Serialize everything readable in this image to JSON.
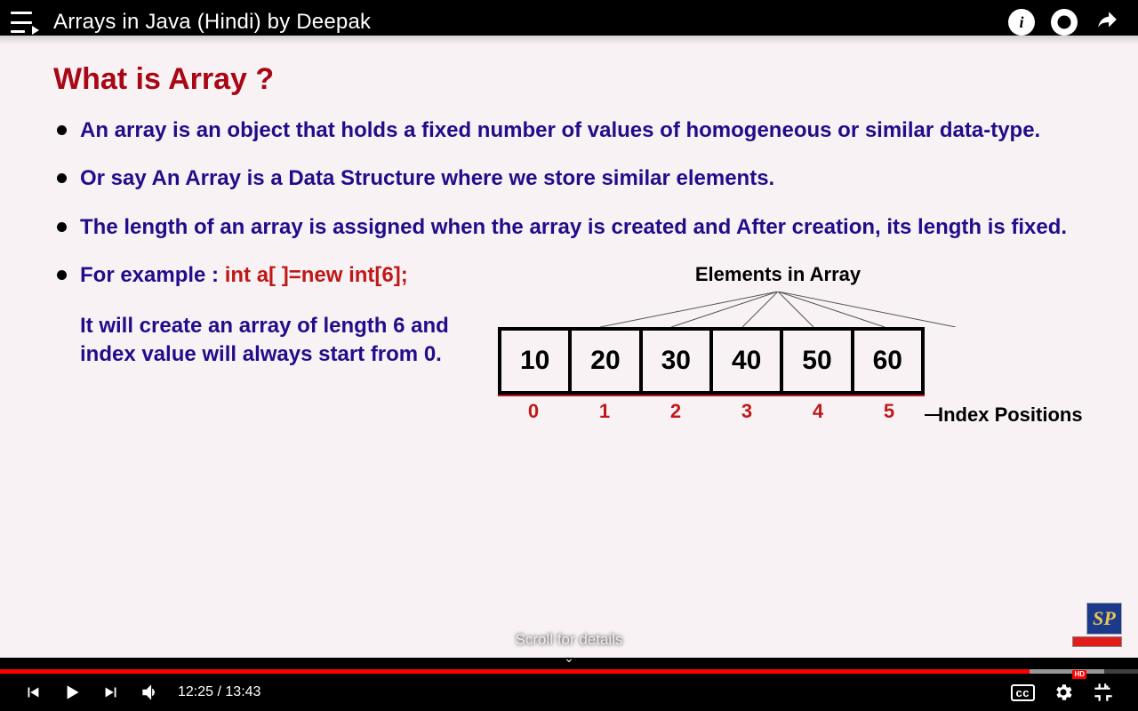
{
  "top": {
    "title": "Arrays in Java (Hindi) by Deepak",
    "info_label": "i"
  },
  "slide": {
    "heading": "What is Array ?",
    "bullets": [
      "An array is an object that holds a fixed number of values of homogeneous or similar data-type.",
      "Or say An Array is a Data Structure where we store similar elements.",
      "The length of an array is assigned when the array is created and After creation, its length is fixed."
    ],
    "example_prefix": "For example : ",
    "example_code": "int a[ ]=new int[6];",
    "example_note": "It will create an array of length 6 and index value will always start from 0.",
    "elements_label": "Elements in Array",
    "cells": [
      "10",
      "20",
      "30",
      "40",
      "50",
      "60"
    ],
    "indices": [
      "0",
      "1",
      "2",
      "3",
      "4",
      "5"
    ],
    "index_label": "Index Positions"
  },
  "logo": {
    "text": "SP"
  },
  "scroll_hint": "Scroll for details",
  "progress": {
    "played_pct": 90.5,
    "buffered_start_pct": 90.5,
    "buffered_end_pct": 97
  },
  "controls": {
    "current_time": "12:25",
    "total_time": "13:43",
    "separator": " / ",
    "cc_label": "cc",
    "hd_label": "HD"
  }
}
